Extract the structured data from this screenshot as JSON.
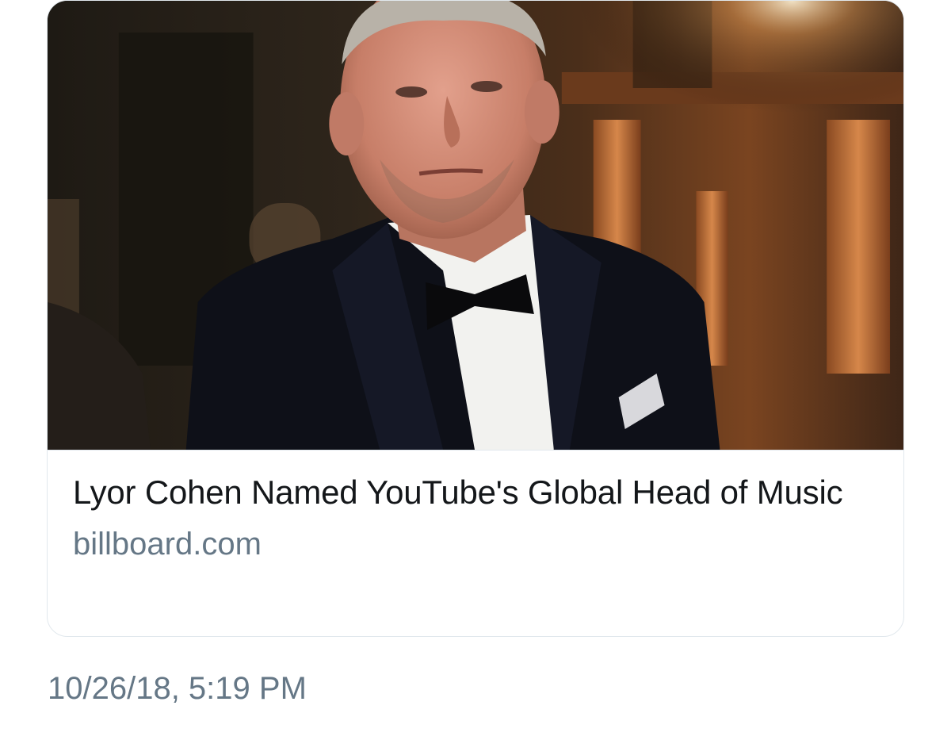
{
  "link_card": {
    "image_alt": "photo-of-man-in-tuxedo",
    "title": "Lyor Cohen Named YouTube's Global Head of Music",
    "domain": "billboard.com"
  },
  "tweet": {
    "timestamp": "10/26/18, 5:19 PM"
  },
  "colors": {
    "title_text": "#14171a",
    "secondary_text": "#657786",
    "card_border": "#e1e8ed"
  }
}
